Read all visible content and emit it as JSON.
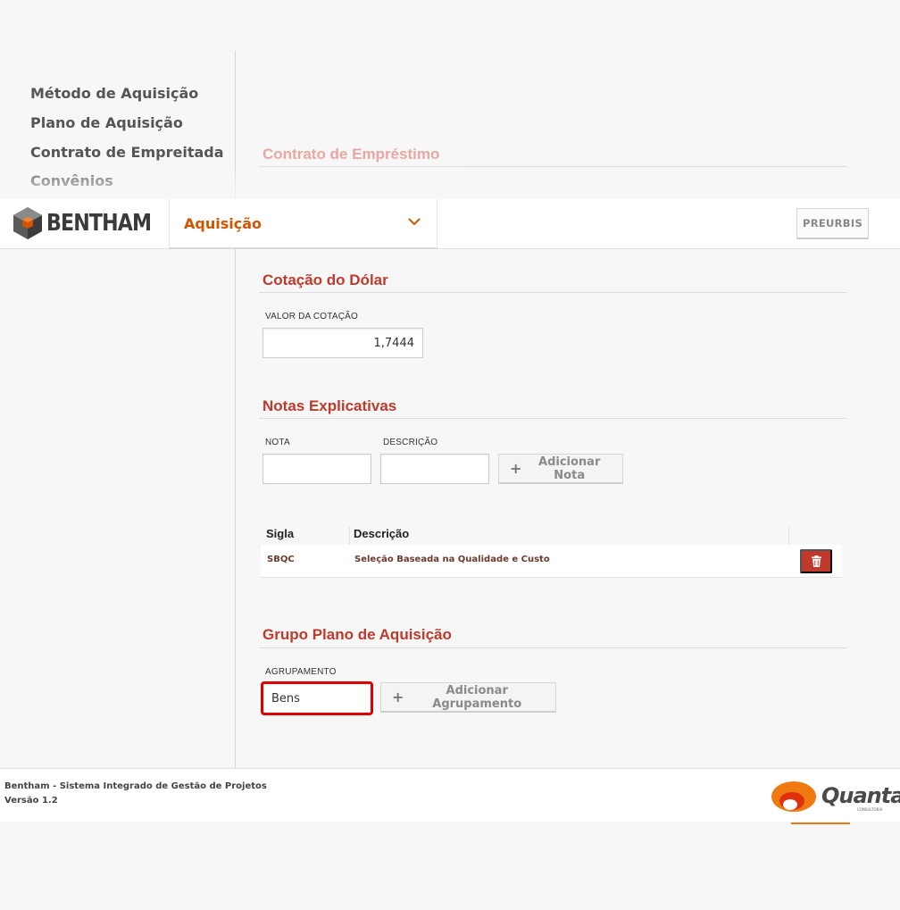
{
  "sidebar": {
    "items": [
      {
        "label": "Método de Aquisição"
      },
      {
        "label": "Plano de Aquisição"
      },
      {
        "label": "Contrato de Empreitada"
      },
      {
        "label": "Convênios"
      }
    ]
  },
  "header": {
    "logo_text": "BENTHAM",
    "module_select": "Aquisição",
    "preurbis_label": "PREURBIS"
  },
  "sections": {
    "contrato_emprestimo": {
      "title": "Contrato de Empréstimo"
    },
    "cotacao": {
      "title": "Cotação do Dólar",
      "valor_label": "VALOR DA COTAÇÃO",
      "valor_value": "1,7444"
    },
    "notas": {
      "title": "Notas Explicativas",
      "nota_label": "NOTA",
      "descricao_label": "DESCRIÇÃO",
      "nota_value": "",
      "descricao_value": "",
      "add_button": "Adicionar Nota",
      "table": {
        "headers": [
          "Sigla",
          "Descrição"
        ],
        "rows": [
          {
            "sigla": "SBQC",
            "descricao": "Seleção Baseada na Qualidade e Custo"
          }
        ]
      }
    },
    "grupo": {
      "title": "Grupo Plano de Aquisição",
      "agrupamento_label": "AGRUPAMENTO",
      "agrupamento_value": "Bens",
      "add_button": "Adicionar Agrupamento"
    }
  },
  "footer": {
    "line1": "Bentham - Sistema Integrado de Gestão de Projetos",
    "line2": "Versão 1.2",
    "brand": "Quanta",
    "brand_sub": "CONSULTORIA"
  },
  "colors": {
    "accent_red": "#c0392b",
    "accent_orange": "#d35400",
    "highlight": "#e00000"
  }
}
